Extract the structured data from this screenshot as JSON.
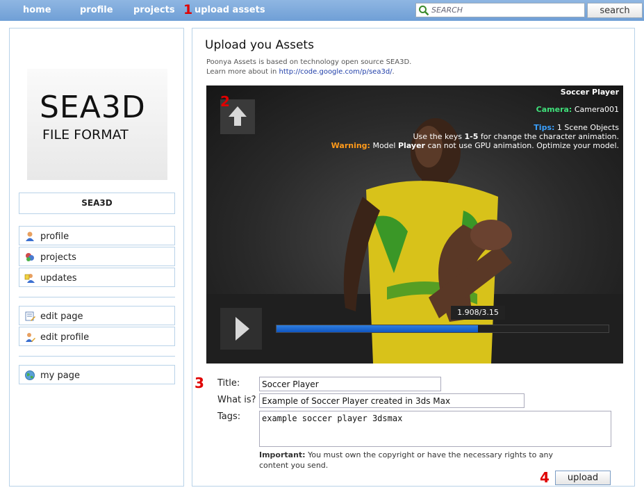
{
  "nav": {
    "items": [
      {
        "label": "home"
      },
      {
        "label": "profile"
      },
      {
        "label": "projects"
      },
      {
        "label": "upload assets"
      }
    ],
    "search_placeholder": "SEARCH",
    "search_button": "search"
  },
  "markers": [
    "1",
    "2",
    "3",
    "4"
  ],
  "sidebar": {
    "logo_line1": "SEA3D",
    "logo_line2": "FILE FORMAT",
    "user_name": "SEA3D",
    "group1": [
      {
        "label": "profile",
        "icon": "user-icon"
      },
      {
        "label": "projects",
        "icon": "projects-icon"
      },
      {
        "label": "updates",
        "icon": "updates-icon"
      }
    ],
    "group2": [
      {
        "label": "edit page",
        "icon": "edit-page-icon"
      },
      {
        "label": "edit profile",
        "icon": "edit-profile-icon"
      }
    ],
    "group3": [
      {
        "label": "my page",
        "icon": "globe-icon"
      }
    ]
  },
  "main": {
    "title": "Upload you Assets",
    "intro_line1": "Poonya Assets is based on technology open source SEA3D.",
    "intro_line2_prefix": "Learn more about in ",
    "intro_link": "http://code.google.com/p/sea3d/",
    "intro_line2_suffix": "."
  },
  "viewer": {
    "title": "Soccer Player",
    "camera_label": "Camera:",
    "camera_value": "Camera001",
    "tips_label": "Tips:",
    "tips_value": "1 Scene Objects",
    "keys_prefix": "Use the keys ",
    "keys_value": "1-5",
    "keys_suffix": " for change the character animation.",
    "warning_label": "Warning:",
    "warning_prefix": " Model ",
    "warning_model": "Player",
    "warning_suffix": " can not use GPU animation. Optimize your model.",
    "time": "1.908/3.15",
    "progress": 0.606,
    "colors": {
      "camera": "#3fe07a",
      "tips": "#3aa0ff",
      "warning": "#ff9a1a"
    }
  },
  "form": {
    "title_label": "Title:",
    "title_value": "Soccer Player",
    "whatis_label": "What is?",
    "whatis_value": "Example of Soccer Player created in 3ds Max",
    "tags_label": "Tags:",
    "tags_value": "example soccer player 3dsmax",
    "important_label": "Important:",
    "important_text": " You must own the copyright or have the necessary rights to any content you send.",
    "upload_button": "upload"
  }
}
